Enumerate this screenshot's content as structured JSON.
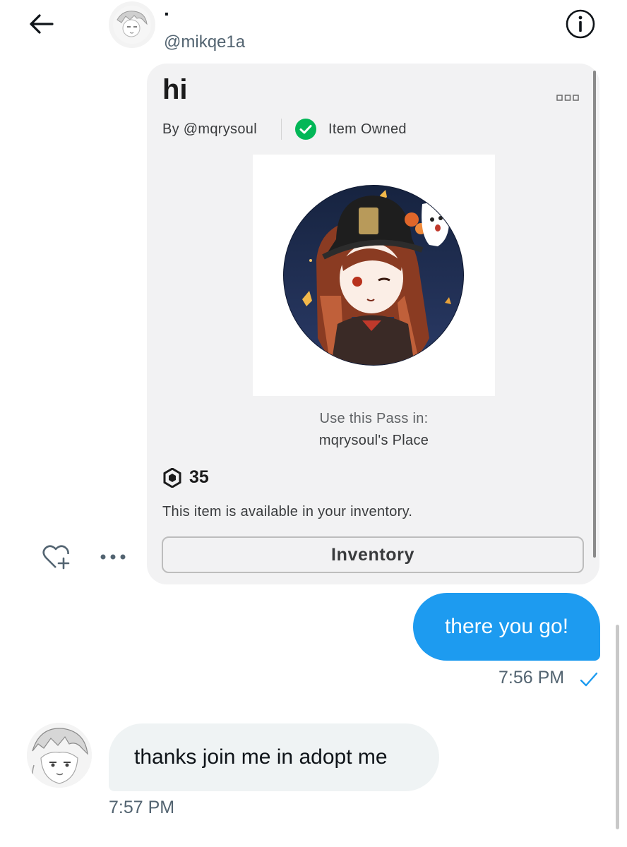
{
  "header": {
    "display_name": "·",
    "handle": "@mikqe1a",
    "back_icon": "arrow-left-icon",
    "info_icon": "info-circle-icon"
  },
  "shared_item": {
    "title": "hi",
    "creator": "By @mqrysoul",
    "owned_label": "Item Owned",
    "use_pass_label": "Use this Pass in:",
    "place_name": "mqrysoul's Place",
    "price": "35",
    "availability": "This item is available in your inventory.",
    "inventory_button": "Inventory",
    "image_description_icon": "anime-character-avatar",
    "colors": {
      "card_bg": "#f2f2f3",
      "owned_green": "#02b757"
    }
  },
  "reactions": {
    "add_reaction_icon": "heart-plus-icon",
    "more_icon": "more-dots-icon"
  },
  "messages": {
    "sent": {
      "text": "there you go!",
      "time": "7:56 PM",
      "bubble_color": "#1d9bf0"
    },
    "received": {
      "text": "thanks join me in adopt me",
      "time": "7:57 PM",
      "bubble_color": "#eff3f4"
    }
  }
}
